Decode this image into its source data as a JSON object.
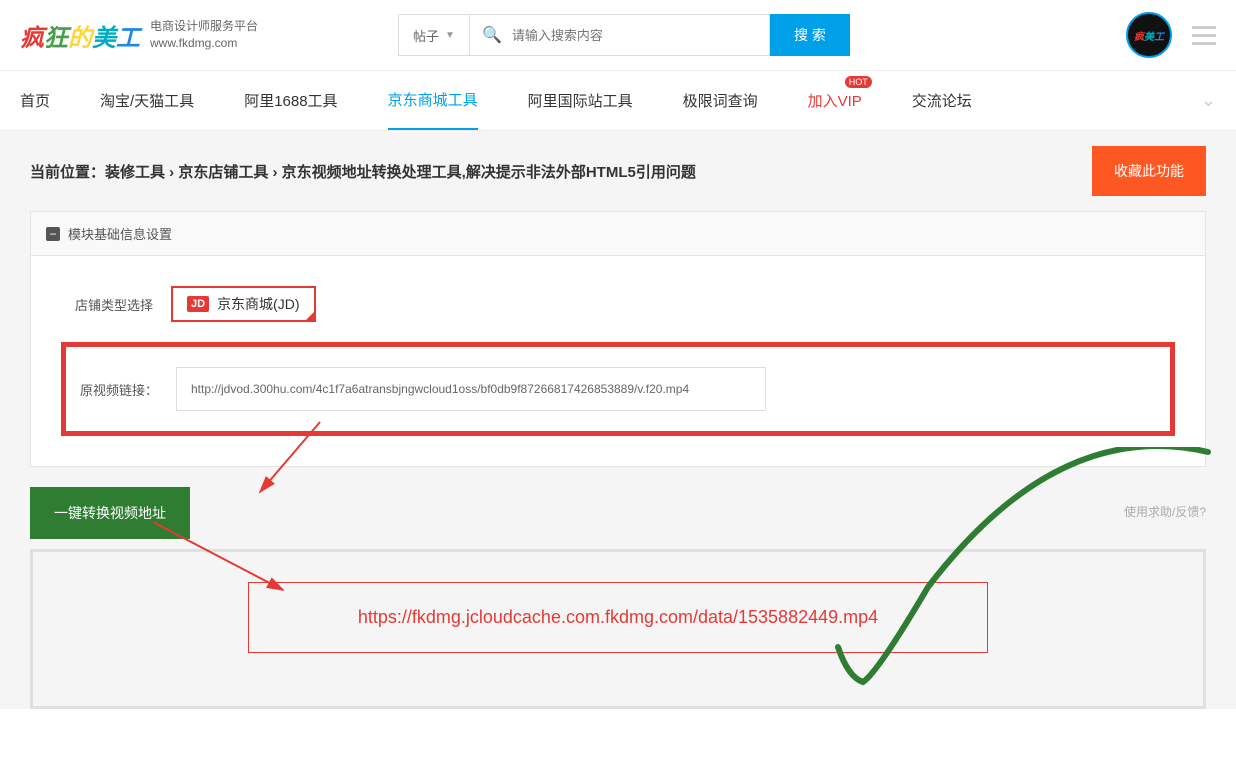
{
  "header": {
    "desc_line1": "电商设计师服务平台",
    "desc_line2": "www.fkdmg.com",
    "search_select": "帖子",
    "search_placeholder": "请输入搜索内容",
    "search_button": "搜 索"
  },
  "nav": {
    "items": [
      {
        "label": "首页"
      },
      {
        "label": "淘宝/天猫工具"
      },
      {
        "label": "阿里1688工具"
      },
      {
        "label": "京东商城工具",
        "active": true
      },
      {
        "label": "阿里国际站工具"
      },
      {
        "label": "极限词查询"
      },
      {
        "label": "加入VIP",
        "vip": true,
        "badge": "HOT"
      },
      {
        "label": "交流论坛"
      }
    ]
  },
  "breadcrumb": {
    "prefix": "当前位置：",
    "path": "装修工具 › 京东店铺工具 › 京东视频地址转换处理工具,解决提示非法外部HTML5引用问题",
    "fav_button": "收藏此功能"
  },
  "panel": {
    "title": "模块基础信息设置",
    "shop_type_label": "店铺类型选择",
    "shop_type_value": "京东商城(JD)",
    "jd_badge": "JD",
    "original_link_label": "原视频链接：",
    "original_link_value": "http://jdvod.300hu.com/4c1f7a6atransbjngwcloud1oss/bf0db9f87266817426853889/v.f20.mp4"
  },
  "convert": {
    "button": "一键转换视频地址",
    "help": "使用求助/反馈?"
  },
  "result": {
    "url": "https://fkdmg.jcloudcache.com.fkdmg.com/data/1535882449.mp4"
  }
}
